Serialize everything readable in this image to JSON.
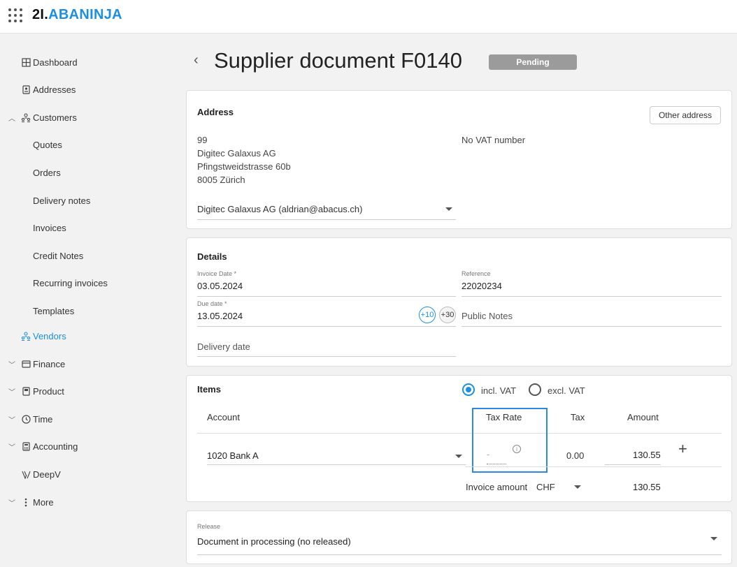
{
  "app": {
    "logo_part1": "2I.",
    "logo_part2": "ABANINJA"
  },
  "sidebar": {
    "items": [
      {
        "label": "Dashboard",
        "icon": "dashboard-icon"
      },
      {
        "label": "Addresses",
        "icon": "addressbook-icon"
      },
      {
        "label": "Customers",
        "icon": "customers-icon",
        "expanded": true
      },
      {
        "label": "Quotes"
      },
      {
        "label": "Orders"
      },
      {
        "label": "Delivery notes"
      },
      {
        "label": "Invoices"
      },
      {
        "label": "Credit Notes"
      },
      {
        "label": "Recurring invoices"
      },
      {
        "label": "Templates"
      },
      {
        "label": "Vendors",
        "icon": "vendors-icon",
        "active": true
      },
      {
        "label": "Finance",
        "icon": "finance-icon"
      },
      {
        "label": "Product",
        "icon": "product-icon"
      },
      {
        "label": "Time",
        "icon": "clock-icon"
      },
      {
        "label": "Accounting",
        "icon": "calculator-icon"
      },
      {
        "label": "DeepV",
        "icon": "deepv-icon"
      },
      {
        "label": "More",
        "icon": "more-icon"
      }
    ]
  },
  "header": {
    "title": "Supplier document F0140",
    "status": "Pending"
  },
  "address": {
    "title": "Address",
    "other_button": "Other address",
    "lines": [
      "99",
      "Digitec Galaxus AG",
      "Pfingstweidstrasse 60b",
      "8005 Zürich"
    ],
    "vat": "No VAT number",
    "contact": "Digitec Galaxus AG (aldrian@abacus.ch)"
  },
  "details": {
    "title": "Details",
    "invoice_date_label": "Invoice Date *",
    "invoice_date": "03.05.2024",
    "reference_label": "Reference",
    "reference": "22020234",
    "due_date_label": "Due date *",
    "due_date": "13.05.2024",
    "plus10": "+10",
    "plus30": "+30",
    "public_notes_placeholder": "Public Notes",
    "delivery_date_placeholder": "Delivery date"
  },
  "items": {
    "title": "Items",
    "incl_vat": "incl. VAT",
    "excl_vat": "excl. VAT",
    "columns": {
      "account": "Account",
      "tax_rate": "Tax Rate",
      "tax": "Tax",
      "amount": "Amount"
    },
    "row": {
      "account": "1020 Bank A",
      "tax_rate": "-",
      "tax": "0.00",
      "amount": "130.55"
    },
    "invoice_amount_label": "Invoice amount",
    "currency": "CHF",
    "total": "130.55"
  },
  "release": {
    "label": "Release",
    "value": "Document in processing (no released)"
  },
  "colors": {
    "accent": "#1a8fe3",
    "badge": "#9b9b9b"
  }
}
